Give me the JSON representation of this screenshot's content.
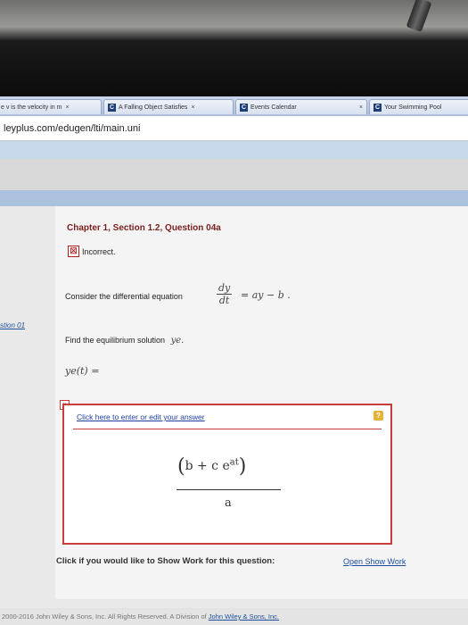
{
  "browser": {
    "tabs": [
      {
        "label": "e v is the velocity in m",
        "favicon": ""
      },
      {
        "label": "A Falling Object Satisfies",
        "favicon": "C"
      },
      {
        "label": "Events Calendar",
        "favicon": "C"
      },
      {
        "label": "Your Swimming Pool",
        "favicon": "C"
      }
    ],
    "tab_close": "×",
    "address": "leyplus.com/edugen/lti/main.uni"
  },
  "sidebar": {
    "link": "stion 01"
  },
  "question": {
    "title": "Chapter 1, Section 1.2, Question 04a",
    "status_icon": "☒",
    "status": "Incorrect.",
    "prompt": "Consider the differential equation",
    "eq_num": "dy",
    "eq_den": "dt",
    "eq_rhs": "= ay − b .",
    "find": "Find the equilibrium solution",
    "find_var": "ye.",
    "ye_label": "ye(t) ="
  },
  "answer": {
    "link": "Click here to enter or edit your answer",
    "help": "?",
    "numerator": "b + c e",
    "exponent": "at",
    "denominator": "a",
    "close": "x"
  },
  "showwork": {
    "prompt": "Click if you would like to Show Work for this question:",
    "link": "Open Show Work"
  },
  "footer": {
    "text": "2000-2016 John Wiley & Sons, Inc. All Rights Reserved. A Division of ",
    "link": "John Wiley & Sons, Inc."
  },
  "colors": {
    "incorrect_red": "#c93c3c",
    "title_maroon": "#7a1f1f",
    "link_blue": "#1d3fa0"
  }
}
